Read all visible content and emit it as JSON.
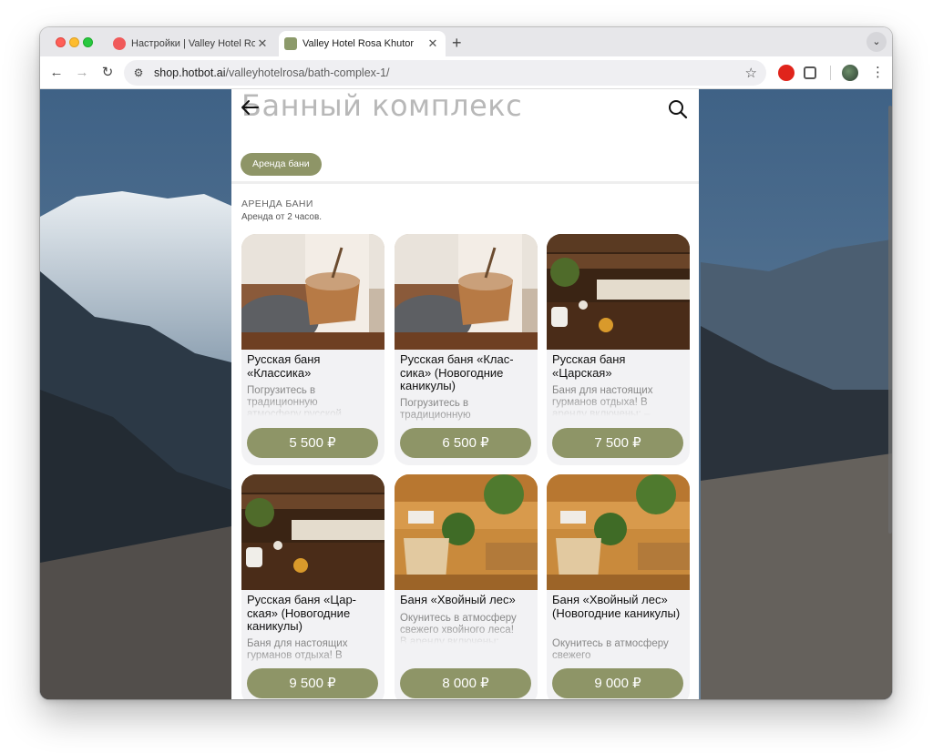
{
  "browser": {
    "tabs": [
      {
        "title": "Настройки | Valley Hotel Rosa Khutor",
        "active": false
      },
      {
        "title": "Valley Hotel Rosa Khutor",
        "active": true
      }
    ],
    "url_host": "shop.hotbot.ai",
    "url_path": "/valleyhotelrosa/bath-complex-1/"
  },
  "page": {
    "title": "Банный комплекс",
    "chip": "Аренда бани",
    "section_title": "АРЕНДА БАНИ",
    "section_subtitle": "Аренда от 2 часов."
  },
  "cards": [
    {
      "name": "Русская баня «Классика»",
      "desc": "Погрузитесь в традиционную атмосферу русской",
      "price": "5 500 ₽",
      "image": "steam-bucket"
    },
    {
      "name": "Русская баня «Клас-сика» (Новогодние каникулы)",
      "desc": "Погрузитесь в традиционную",
      "price": "6 500 ₽",
      "image": "steam-bucket"
    },
    {
      "name": "Русская баня «Царская»",
      "desc": "Баня для настоящих гурманов отдыха! В аренду включены: –",
      "price": "7 500 ₽",
      "image": "sauna-bench"
    },
    {
      "name": "Русская баня «Цар-ская» (Новогодние каникулы)",
      "desc": "Баня для настоящих гурманов отдыха! В",
      "price": "9 500 ₽",
      "image": "sauna-bench"
    },
    {
      "name": "Баня «Хвойный лес»",
      "desc": "Окунитесь в атмосферу свежего хвойного леса! В аренду включены:",
      "price": "8 000 ₽",
      "image": "pine-tub"
    },
    {
      "name": "Баня «Хвойный лес» (Новогодние каникулы)",
      "desc": "Окунитесь в атмосферу свежего",
      "price": "9 000 ₽",
      "image": "pine-tub"
    }
  ],
  "colors": {
    "accent": "#8e9567",
    "title_gray": "#b8b8b8"
  }
}
